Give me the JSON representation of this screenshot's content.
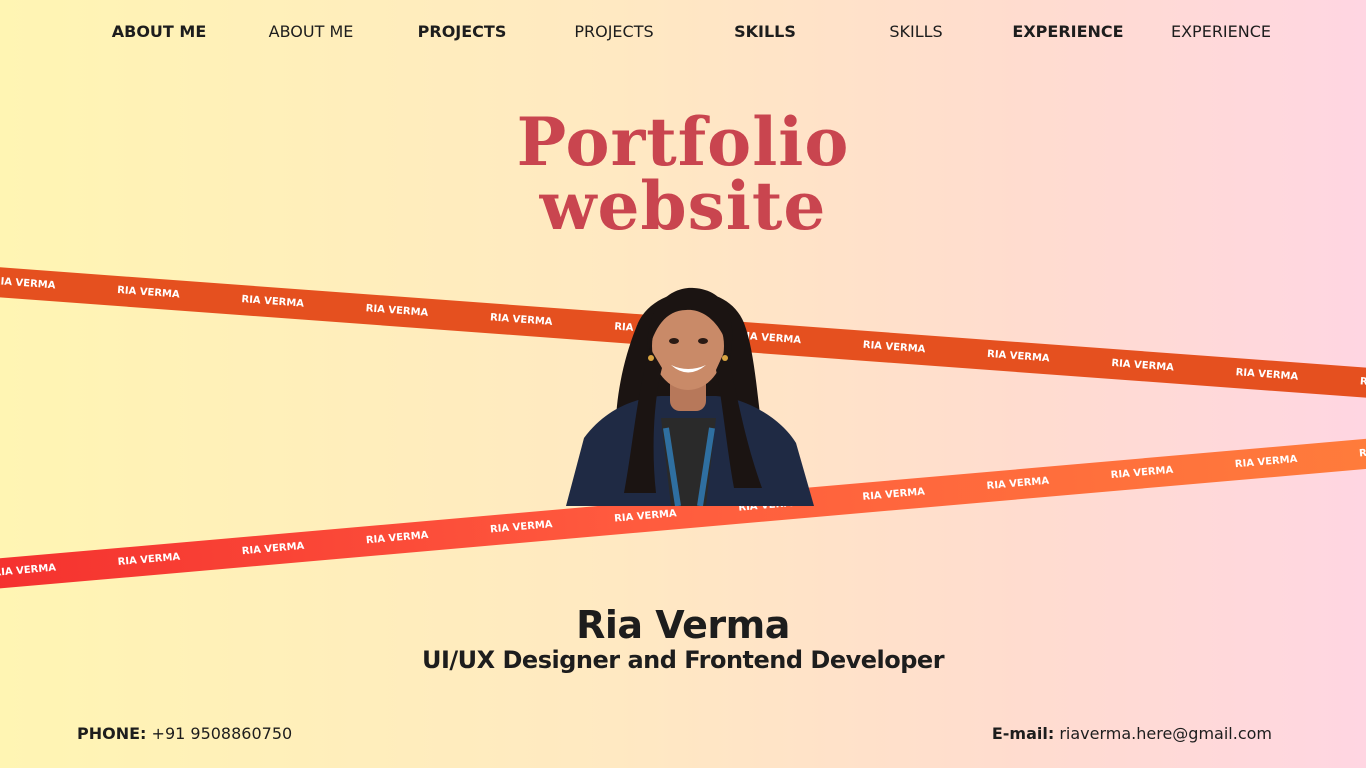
{
  "nav": {
    "items": [
      {
        "label": "ABOUT ME",
        "bold": true
      },
      {
        "label": "ABOUT ME",
        "bold": false
      },
      {
        "label": "PROJECTS",
        "bold": true
      },
      {
        "label": "PROJECTS",
        "bold": false
      },
      {
        "label": "SKILLS",
        "bold": true
      },
      {
        "label": "SKILLS",
        "bold": false
      },
      {
        "label": "EXPERIENCE",
        "bold": true
      },
      {
        "label": "EXPERIENCE",
        "bold": false
      }
    ]
  },
  "hero": {
    "title_line1": "Portfolio",
    "title_line2": "website",
    "ribbon_text": "RIA VERMA"
  },
  "profile": {
    "name": "Ria Verma",
    "role": "UI/UX Designer and Frontend Developer"
  },
  "contact": {
    "phone_label": "PHONE:",
    "phone_value": "+91 9508860750",
    "email_label": "E-mail:",
    "email_value": "riaverma.here@gmail.com"
  },
  "colors": {
    "title": "#c9454f",
    "ribbon_top": "#e5501f",
    "ribbon_bottom_start": "#f42f2e",
    "ribbon_bottom_end": "#ff7e3b"
  }
}
